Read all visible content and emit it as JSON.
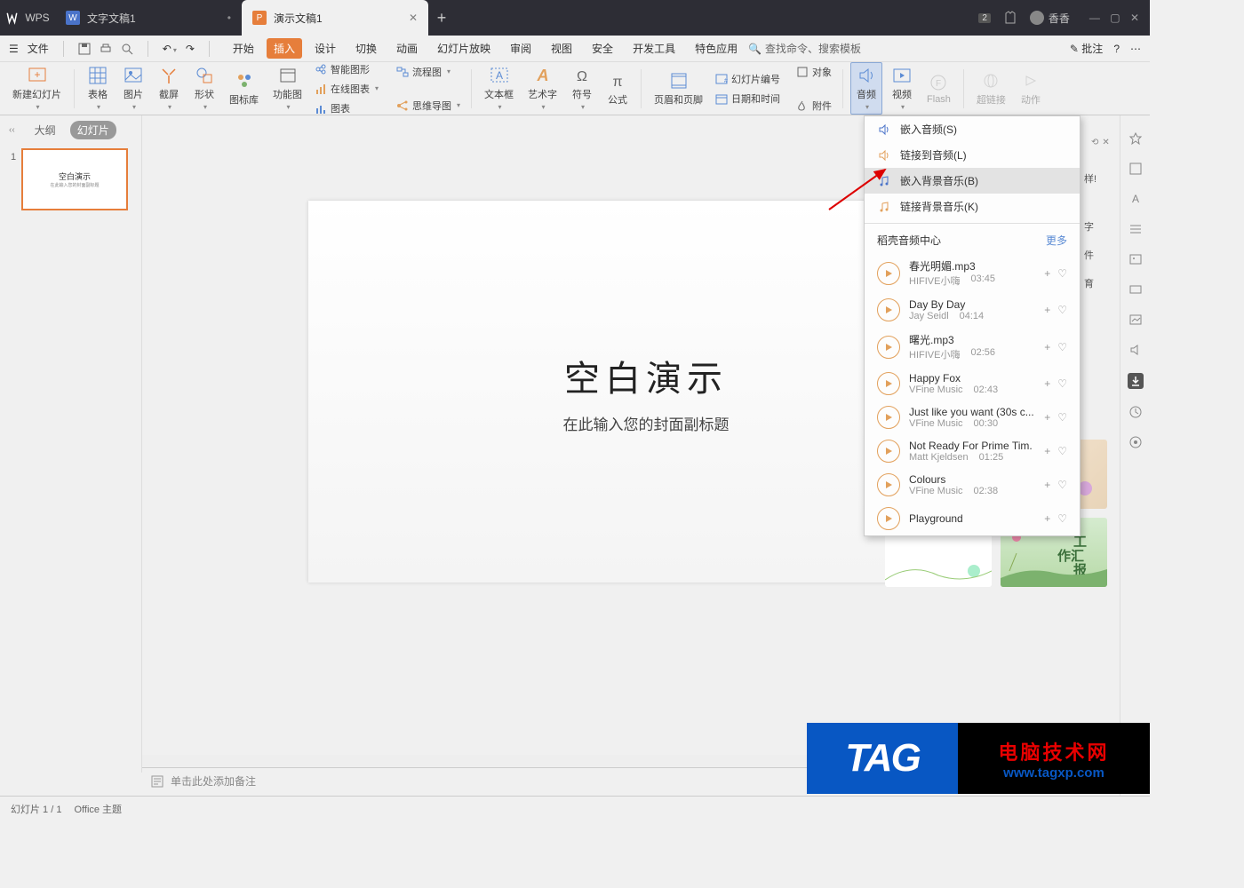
{
  "titlebar": {
    "app": "WPS",
    "tabs": [
      {
        "label": "文字文稿1",
        "type": "word",
        "active": false
      },
      {
        "label": "演示文稿1",
        "type": "ppt",
        "active": true
      }
    ],
    "newtab": "+",
    "badge": "2",
    "user": "香香",
    "win": {
      "min": "—",
      "max": "▢",
      "close": "✕"
    }
  },
  "menubar": {
    "file": "文件",
    "items": [
      "开始",
      "插入",
      "设计",
      "切换",
      "动画",
      "幻灯片放映",
      "审阅",
      "视图",
      "安全",
      "开发工具",
      "特色应用"
    ],
    "active": "插入",
    "search": "查找命令、搜索模板",
    "annotate": "批注"
  },
  "ribbon": {
    "new_slide": "新建幻灯片",
    "table": "表格",
    "picture": "图片",
    "screenshot": "截屏",
    "shape": "形状",
    "iconlib": "图标库",
    "funcimg": "功能图",
    "smart": "智能图形",
    "onlinechart": "在线图表",
    "chart": "图表",
    "flow": "流程图",
    "mindmap": "思维导图",
    "textbox": "文本框",
    "wordart": "艺术字",
    "symbol": "符号",
    "equation": "公式",
    "headerfooter": "页眉和页脚",
    "slidenum": "幻灯片编号",
    "datetime": "日期和时间",
    "object": "对象",
    "attach": "附件",
    "audio": "音频",
    "video": "视频",
    "flash": "Flash",
    "hyperlink": "超链接",
    "action": "动作"
  },
  "slides_panel": {
    "outline": "大纲",
    "slides": "幻灯片",
    "thumb_num": "1",
    "thumb_title": "空白演示",
    "thumb_sub": "在此输入您的封面副标题"
  },
  "slide": {
    "title": "空白演示",
    "subtitle": "在此输入您的封面副标题"
  },
  "dropdown": {
    "items": [
      {
        "label": "嵌入音频(S)",
        "hovered": false
      },
      {
        "label": "链接到音频(L)",
        "hovered": false
      },
      {
        "label": "嵌入背景音乐(B)",
        "hovered": true
      },
      {
        "label": "链接背景音乐(K)",
        "hovered": false
      }
    ],
    "center_title": "稻壳音频中心",
    "more": "更多",
    "audios": [
      {
        "title": "春光明媚.mp3",
        "artist": "HIFIVE小嗨",
        "dur": "03:45"
      },
      {
        "title": "Day By Day",
        "artist": "Jay Seidl",
        "dur": "04:14"
      },
      {
        "title": "曙光.mp3",
        "artist": "HIFIVE小嗨",
        "dur": "02:56"
      },
      {
        "title": "Happy Fox",
        "artist": "VFine Music",
        "dur": "02:43"
      },
      {
        "title": "Just like you want (30s c...",
        "artist": "VFine Music",
        "dur": "00:30"
      },
      {
        "title": "Not Ready For Prime Tim.",
        "artist": "Matt Kjeldsen",
        "dur": "01:25"
      },
      {
        "title": "Colours",
        "artist": "VFine Music",
        "dur": "02:38"
      },
      {
        "title": "Playground",
        "artist": "",
        "dur": ""
      }
    ]
  },
  "side_peek": {
    "a": "样!",
    "b": "字",
    "c": "件",
    "d": "育"
  },
  "notes": {
    "placeholder": "单击此处添加备注"
  },
  "status": {
    "slide": "幻灯片 1 / 1",
    "theme": "Office 主题"
  },
  "watermark": {
    "tag": "TAG",
    "line1": "电脑技术网",
    "line2": "www.tagxp.com"
  }
}
